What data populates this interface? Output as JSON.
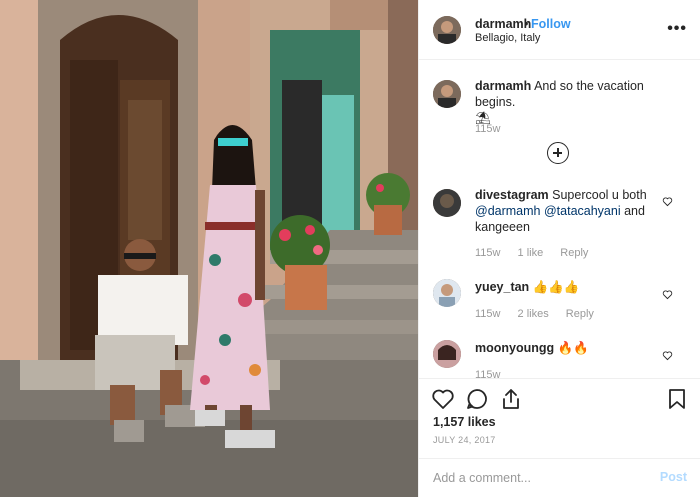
{
  "post": {
    "author": {
      "username": "darmamh",
      "separator": "•",
      "follow_label": "Follow",
      "location": "Bellagio, Italy"
    },
    "more_icon": "more-horizontal-icon",
    "caption": {
      "username": "darmamh",
      "text": "And so the vacation begins.",
      "emoji": "⛱",
      "age": "115w"
    },
    "load_more_icon": "plus-circle-icon",
    "comments": [
      {
        "username": "divestagram",
        "text_before": "Supercool u both ",
        "mention1": "@darmamh",
        "mention2": "@tatacahyani",
        "text_after": " and kangeeen",
        "age": "115w",
        "likes": "1 like",
        "reply": "Reply"
      },
      {
        "username": "yuey_tan",
        "text": "👍👍👍",
        "age": "115w",
        "likes": "2 likes",
        "reply": "Reply"
      },
      {
        "username": "moonyoungg",
        "text": "🔥🔥",
        "age": "115w"
      }
    ],
    "likes_count": "1,157 likes",
    "date": "JULY 24, 2017",
    "add_comment": {
      "placeholder": "Add a comment...",
      "post_label": "Post"
    },
    "colors": {
      "link": "#3897f0",
      "mention": "#003569",
      "muted": "#999999",
      "post_disabled": "#b3dbff"
    }
  }
}
